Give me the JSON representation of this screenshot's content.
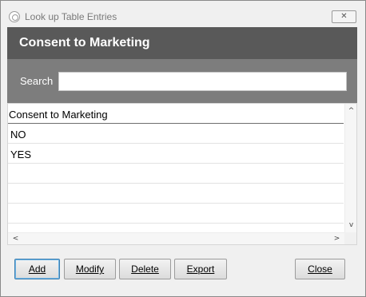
{
  "window": {
    "title": "Look up Table Entries",
    "close_glyph": "✕"
  },
  "header": {
    "title": "Consent to Marketing"
  },
  "search": {
    "label": "Search",
    "value": "",
    "placeholder": ""
  },
  "table": {
    "columns": [
      "Consent to Marketing"
    ],
    "rows": [
      [
        "NO"
      ],
      [
        "YES"
      ],
      [
        ""
      ],
      [
        ""
      ],
      [
        ""
      ]
    ]
  },
  "scroll": {
    "up": "^",
    "down": "v",
    "left": "<",
    "right": ">"
  },
  "buttons": {
    "add": "Add",
    "modify": "Modify",
    "delete": "Delete",
    "export": "Export",
    "close": "Close"
  },
  "icons": {
    "app": "app-circle-icon"
  }
}
